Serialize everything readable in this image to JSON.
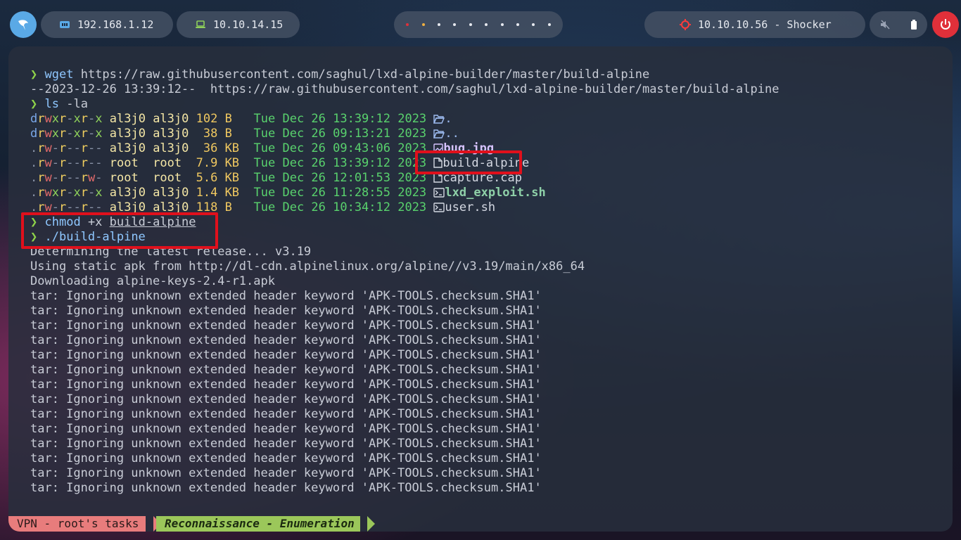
{
  "topbar": {
    "network_local": "192.168.1.12",
    "network_vpn": "10.10.14.15",
    "workspace_count": 10,
    "target": "10.10.10.56 - Shocker"
  },
  "terminal": {
    "prompt_symbol": "❯",
    "wget": {
      "cmd": "wget",
      "url": "https://raw.githubusercontent.com/saghul/lxd-alpine-builder/master/build-alpine",
      "output": "--2023-12-26 13:39:12--  https://raw.githubusercontent.com/saghul/lxd-alpine-builder/master/build-alpine"
    },
    "ls": {
      "cmd": "ls",
      "args": "-la"
    },
    "listing": [
      {
        "perm": "drwxr-xr-x",
        "user": "al3j0",
        "group": "al3j0",
        "size": "102 B ",
        "date": "Tue Dec 26 13:39:12 2023",
        "icon": "folder-open-icon",
        "name": "."
      },
      {
        "perm": "drwxr-xr-x",
        "user": "al3j0",
        "group": "al3j0",
        "size": " 38 B ",
        "date": "Tue Dec 26 09:13:21 2023",
        "icon": "folder-open-icon",
        "name": ".."
      },
      {
        "perm": ".rw-r--r--",
        "user": "al3j0",
        "group": "al3j0",
        "size": " 36 KB",
        "date": "Tue Dec 26 09:43:06 2023",
        "icon": "image-icon",
        "name": "bug.jpg"
      },
      {
        "perm": ".rw-r--r--",
        "user": "root ",
        "group": "root ",
        "size": "7.9 KB",
        "date": "Tue Dec 26 13:39:12 2023",
        "icon": "file-icon",
        "name": "build-alpine"
      },
      {
        "perm": ".rw-r--rw-",
        "user": "root ",
        "group": "root ",
        "size": "5.6 KB",
        "date": "Tue Dec 26 12:01:53 2023",
        "icon": "file-icon",
        "name": "capture.cap"
      },
      {
        "perm": ".rwxr-xr-x",
        "user": "al3j0",
        "group": "al3j0",
        "size": "1.4 KB",
        "date": "Tue Dec 26 11:28:55 2023",
        "icon": "terminal-icon",
        "name": "lxd_exploit.sh"
      },
      {
        "perm": ".rw-r--r--",
        "user": "al3j0",
        "group": "al3j0",
        "size": "118 B ",
        "date": "Tue Dec 26 10:34:12 2023",
        "icon": "terminal-icon",
        "name": "user.sh"
      }
    ],
    "chmod": {
      "cmd": "chmod",
      "args": "+x",
      "target": "build-alpine"
    },
    "run": {
      "cmd": "./build-alpine"
    },
    "output_lines": [
      "Determining the latest release... v3.19",
      "Using static apk from http://dl-cdn.alpinelinux.org/alpine//v3.19/main/x86_64",
      "Downloading alpine-keys-2.4-r1.apk",
      "tar: Ignoring unknown extended header keyword 'APK-TOOLS.checksum.SHA1'",
      "tar: Ignoring unknown extended header keyword 'APK-TOOLS.checksum.SHA1'",
      "tar: Ignoring unknown extended header keyword 'APK-TOOLS.checksum.SHA1'",
      "tar: Ignoring unknown extended header keyword 'APK-TOOLS.checksum.SHA1'",
      "tar: Ignoring unknown extended header keyword 'APK-TOOLS.checksum.SHA1'",
      "tar: Ignoring unknown extended header keyword 'APK-TOOLS.checksum.SHA1'",
      "tar: Ignoring unknown extended header keyword 'APK-TOOLS.checksum.SHA1'",
      "tar: Ignoring unknown extended header keyword 'APK-TOOLS.checksum.SHA1'",
      "tar: Ignoring unknown extended header keyword 'APK-TOOLS.checksum.SHA1'",
      "tar: Ignoring unknown extended header keyword 'APK-TOOLS.checksum.SHA1'",
      "tar: Ignoring unknown extended header keyword 'APK-TOOLS.checksum.SHA1'",
      "tar: Ignoring unknown extended header keyword 'APK-TOOLS.checksum.SHA1'",
      "tar: Ignoring unknown extended header keyword 'APK-TOOLS.checksum.SHA1'",
      "tar: Ignoring unknown extended header keyword 'APK-TOOLS.checksum.SHA1'"
    ]
  },
  "statusline": {
    "session": "VPN - root's tasks",
    "window": "Reconnaissance - Enumeration"
  },
  "colors": {
    "prompt": "#8fd34a",
    "highlight_box": "#e0101c",
    "status_seg1": "#e87c7c",
    "status_seg2": "#9bc75a"
  }
}
